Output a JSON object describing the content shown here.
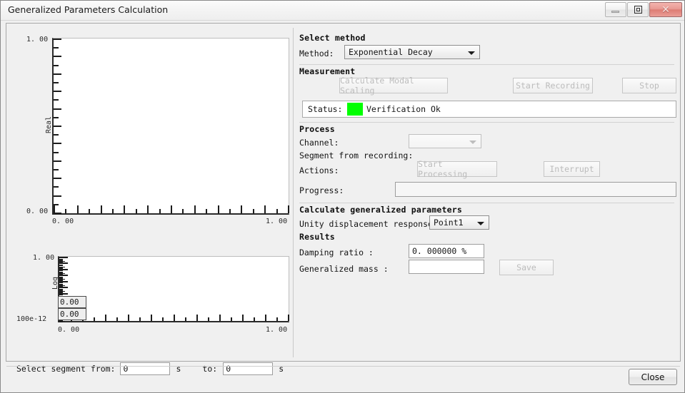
{
  "window": {
    "title": "Generalized Parameters Calculation",
    "buttons": {
      "minimize": "minimize-button",
      "maximize": "maximize-button",
      "close_glyph": "✕"
    }
  },
  "charts": [
    {
      "id": "real-chart",
      "ylabel": "Real",
      "y_max_label": "1. 00",
      "y_min_label": "0. 00",
      "x_min_label": "0. 00",
      "x_max_label": "1. 00",
      "scale": "linear",
      "y_ticks": 20,
      "x_ticks": 21
    },
    {
      "id": "log-chart",
      "ylabel": "Log",
      "y_max_label": "1. 00",
      "y_min_label": "100e-12",
      "x_min_label": "0. 00",
      "x_max_label": "1. 00",
      "scale": "log",
      "value_box_top": "0.00",
      "value_box_bottom": "0.00"
    }
  ],
  "segment": {
    "label": "Select segment from:",
    "from_value": "0",
    "unit_from": "s",
    "to_label": "to:",
    "to_value": "0",
    "unit_to": "s"
  },
  "right": {
    "select_method": {
      "group_title": "Select method",
      "method_label": "Method:",
      "method_value": "Exponential Decay"
    },
    "measurement": {
      "group_title": "Measurement",
      "calculate_modal_scaling": "Calculate Modal Scaling",
      "start_recording": "Start Recording",
      "stop": "Stop",
      "status_label": "Status:",
      "status_color": "#00ff00",
      "status_text": "Verification Ok"
    },
    "process": {
      "group_title": "Process",
      "channel_label": "Channel:",
      "channel_value": "",
      "segment_from_recording_label": "Segment from recording:",
      "actions_label": "Actions:",
      "start_processing": "Start Processing",
      "interrupt": "Interrupt",
      "progress_label": "Progress:",
      "progress_value": ""
    },
    "calculate": {
      "group_title": "Calculate generalized parameters",
      "unity_label": "Unity displacement response:",
      "unity_value": "Point1"
    },
    "results": {
      "group_title": "Results",
      "damping_label": "Damping ratio :",
      "damping_value": "0. 000000 %",
      "mass_label": "Generalized mass :",
      "mass_value": "",
      "save": "Save"
    }
  },
  "footer": {
    "close": "Close"
  }
}
